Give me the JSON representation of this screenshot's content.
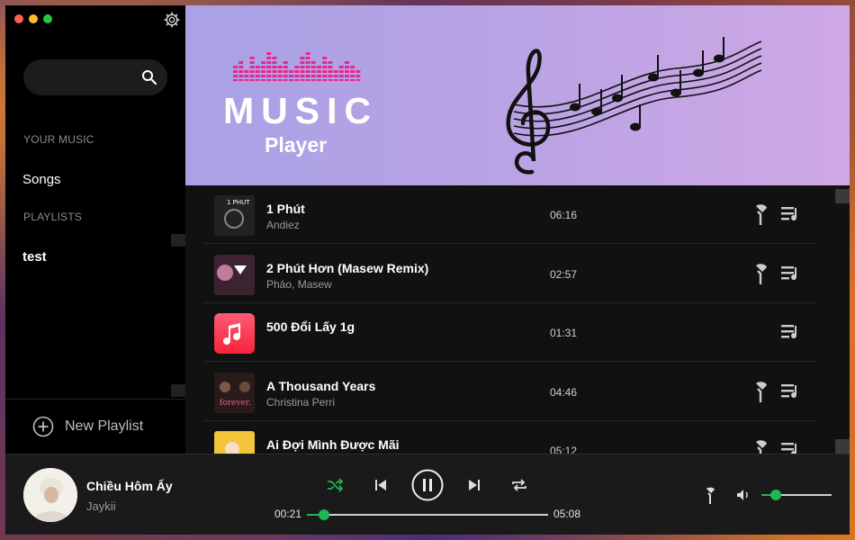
{
  "sidebar": {
    "search": {
      "placeholder": ""
    },
    "section_your_music": "YOUR MUSIC",
    "songs_label": "Songs",
    "section_playlists": "PLAYLISTS",
    "playlists": [
      "test"
    ],
    "new_playlist_label": "New Playlist"
  },
  "banner": {
    "title": "MUSIC",
    "subtitle": "Player"
  },
  "songs": [
    {
      "title": "1 Phút",
      "artist": "Andiez",
      "duration": "06:16",
      "has_lyrics": true,
      "thumb": "dark"
    },
    {
      "title": "2 Phút Hơn (Masew Remix)",
      "artist": "Pháo,  Masew",
      "duration": "02:57",
      "has_lyrics": true,
      "thumb": "purple"
    },
    {
      "title": "500 Đổi Lấy 1g",
      "artist": "",
      "duration": "01:31",
      "has_lyrics": false,
      "thumb": "music-app"
    },
    {
      "title": "A Thousand Years",
      "artist": "Christina Perri",
      "duration": "04:46",
      "has_lyrics": true,
      "thumb": "forever"
    },
    {
      "title": "Ai Đợi Mình Được Mãi",
      "artist": "",
      "duration": "05:12",
      "has_lyrics": true,
      "thumb": "yellow"
    }
  ],
  "now_playing": {
    "title": "Chiều Hôm Ấy",
    "artist": "Jaykii",
    "elapsed": "00:21",
    "total": "05:08",
    "progress": 0.07,
    "volume": 0.2
  },
  "colors": {
    "accent": "#1db954",
    "banner_start": "#a9a1e6",
    "banner_end": "#d0a8e6",
    "logo_bars": "#e8288f"
  }
}
